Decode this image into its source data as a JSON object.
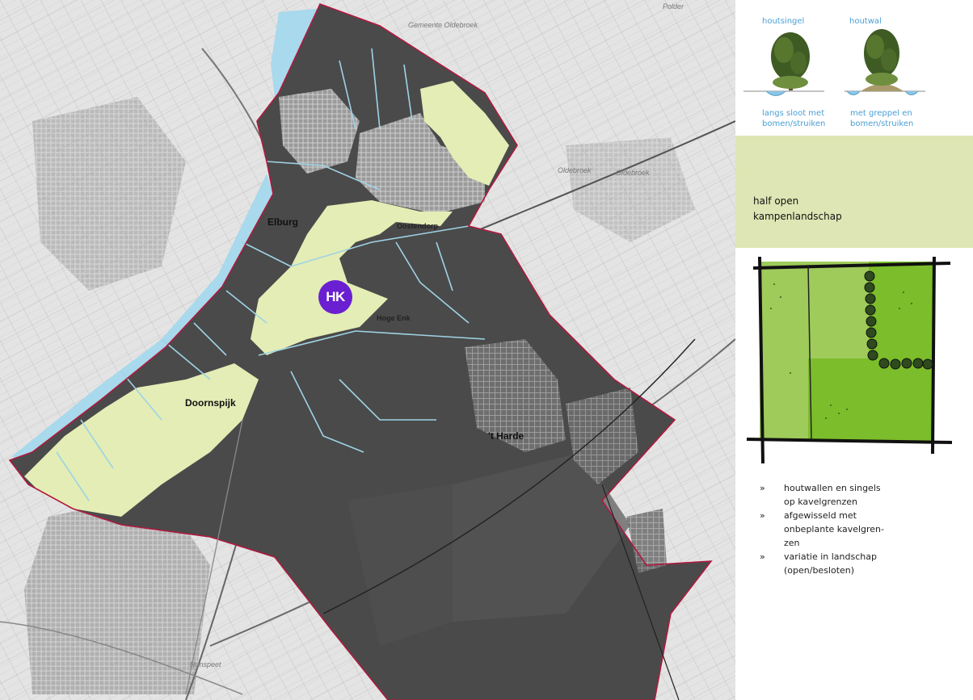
{
  "map": {
    "marker_label": "HK",
    "places": {
      "elburg": "Elburg",
      "oostendorp": "Oostendorp",
      "hoge_enk": "Hoge Enk",
      "doornspijk": "Doornspijk",
      "t_harde": "'t Harde",
      "oldebroek_1": "Oldebroek",
      "oldebroek_2": "Oldebroek",
      "nunspeet": "Nunspeet",
      "polder": "Polder"
    },
    "colors": {
      "boundary": "#b0193f",
      "dark_zone": "#4a4a4a",
      "light_zone": "#e3edb5",
      "water": "#a8d9ec",
      "marker": "#6a1fd1"
    }
  },
  "legend": {
    "houtsingel": {
      "title": "houtsingel",
      "caption_1": "langs sloot met",
      "caption_2": "bomen/struiken"
    },
    "houtwal": {
      "title": "houtwal",
      "caption_1": "met greppel en",
      "caption_2": "bomen/struiken"
    }
  },
  "landscape": {
    "title_line_1": "half open",
    "title_line_2": "kampenlandschap",
    "colors": {
      "title_bg": "#dde6b4",
      "field_light": "#9fcb5a",
      "field_bright": "#7bbd2a"
    }
  },
  "bullets": [
    {
      "marker": "»",
      "line_1": "houtwallen en singels",
      "line_2": "op kavelgrenzen"
    },
    {
      "marker": "»",
      "line_1": "afgewisseld met",
      "line_2": "onbeplante kavelgren-",
      "line_3": "zen"
    },
    {
      "marker": "»",
      "line_1": "variatie in landschap",
      "line_2": "(open/besloten)"
    }
  ]
}
